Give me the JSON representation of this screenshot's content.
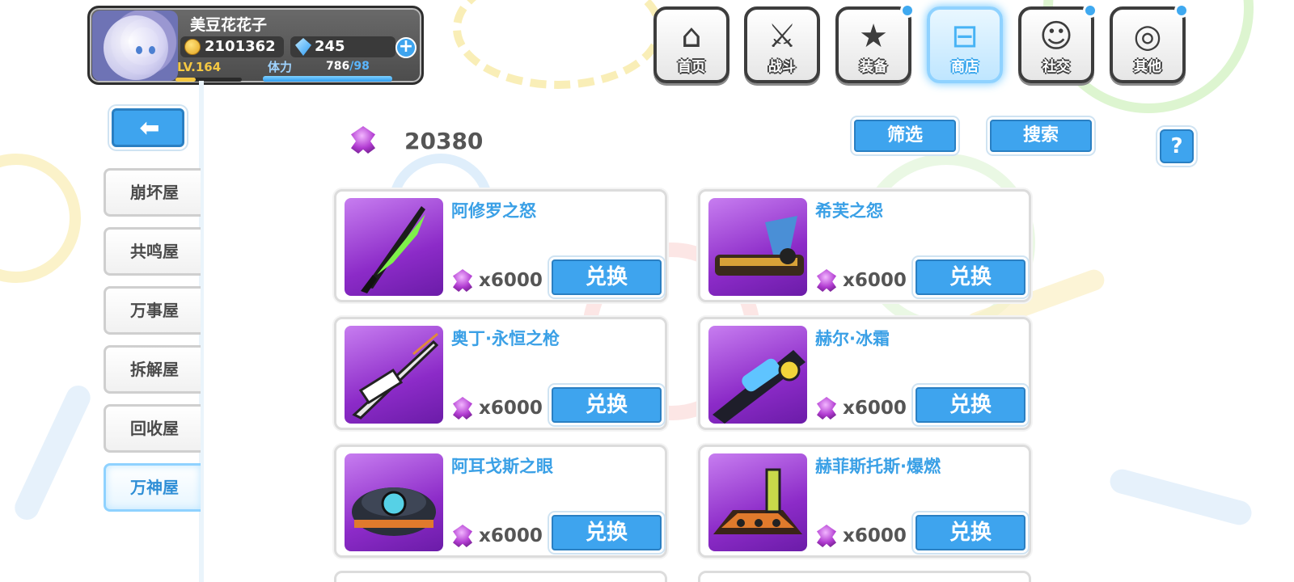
{
  "player": {
    "name": "美豆花花子",
    "gold": "2101362",
    "crystals": "245",
    "level": "LV.164",
    "level_progress": 0.3,
    "stamina_label": "体力",
    "stamina_current": "786",
    "stamina_max": "/98",
    "stamina_progress": 1.0
  },
  "nav": {
    "items": [
      {
        "label": "首页",
        "icon": "home-icon",
        "active": false,
        "dot": false
      },
      {
        "label": "战斗",
        "icon": "battle-icon",
        "active": false,
        "dot": false
      },
      {
        "label": "装备",
        "icon": "equipment-icon",
        "active": false,
        "dot": true
      },
      {
        "label": "商店",
        "icon": "shop-icon",
        "active": true,
        "dot": false
      },
      {
        "label": "社交",
        "icon": "social-icon",
        "active": false,
        "dot": true
      },
      {
        "label": "其他",
        "icon": "other-icon",
        "active": false,
        "dot": true
      }
    ]
  },
  "sidebar": {
    "back_icon": "back-arrow-icon",
    "tabs": [
      {
        "label": "崩坏屋",
        "active": false
      },
      {
        "label": "共鸣屋",
        "active": false
      },
      {
        "label": "万事屋",
        "active": false
      },
      {
        "label": "拆解屋",
        "active": false
      },
      {
        "label": "回收屋",
        "active": false
      },
      {
        "label": "万神屋",
        "active": true
      }
    ]
  },
  "shop": {
    "currency_icon": "purple-gem-icon",
    "currency_amount": "20380",
    "filter_label": "筛选",
    "search_label": "搜索",
    "help_label": "?",
    "items": [
      {
        "name": "阿修罗之怒",
        "price": "x6000",
        "buy_label": "兑换"
      },
      {
        "name": "希芙之怨",
        "price": "x6000",
        "buy_label": "兑换"
      },
      {
        "name": "奥丁·永恒之枪",
        "price": "x6000",
        "buy_label": "兑换"
      },
      {
        "name": "赫尔·冰霜",
        "price": "x6000",
        "buy_label": "兑换"
      },
      {
        "name": "阿耳戈斯之眼",
        "price": "x6000",
        "buy_label": "兑换"
      },
      {
        "name": "赫菲斯托斯·爆燃",
        "price": "x6000",
        "buy_label": "兑换"
      }
    ]
  },
  "colors": {
    "accent_blue": "#3ea4ee",
    "title_blue": "#3aa0e6",
    "item_bg_purple": "#8c2bc8",
    "gold_text": "#f5c842"
  }
}
